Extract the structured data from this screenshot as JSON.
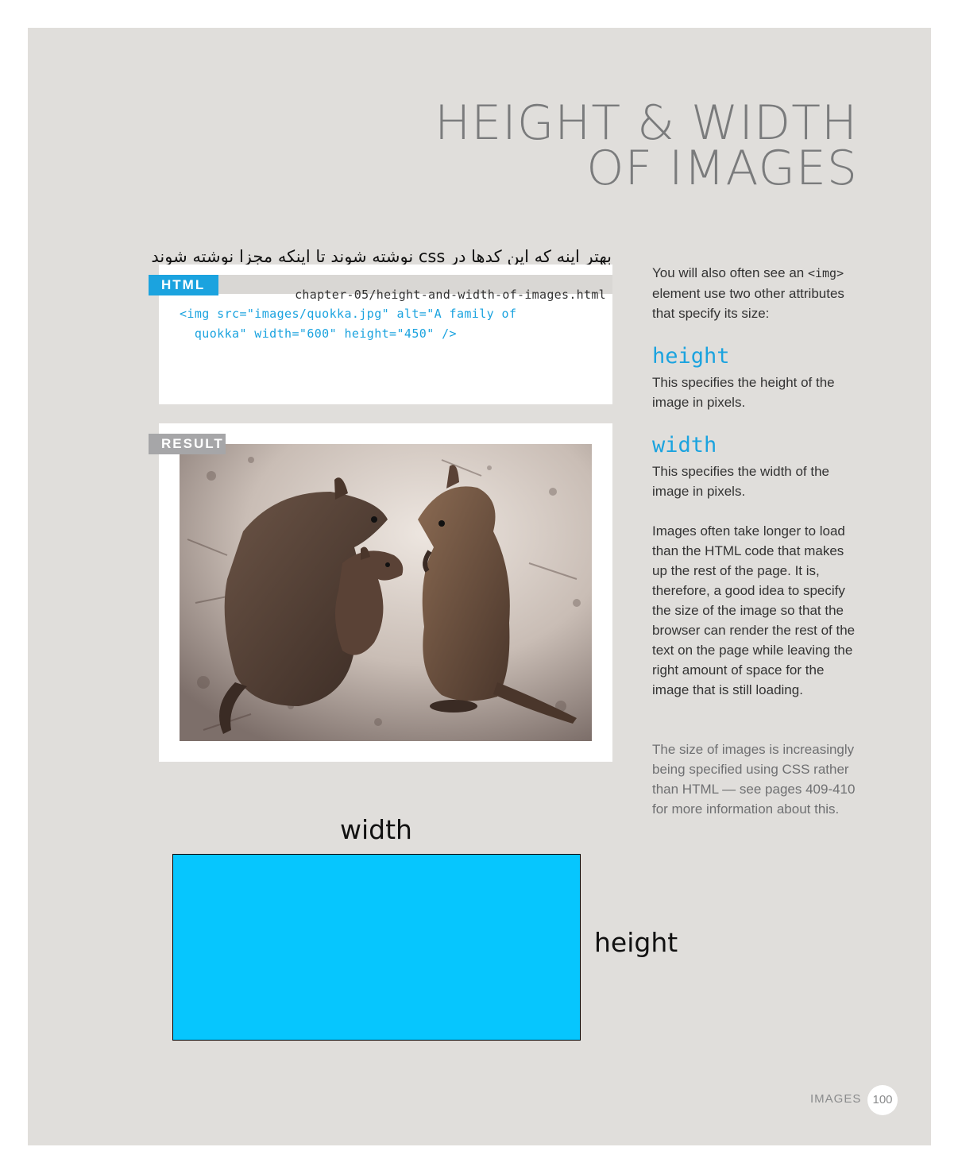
{
  "title": {
    "line1": "HEIGHT & WIDTH",
    "line2": "OF IMAGES"
  },
  "annotation": "بهتر اینه که این کدها در css نوشته شوند تا اینکه مجزا نوشته شوند",
  "html_panel": {
    "tag": "HTML",
    "filename": "chapter-05/height-and-width-of-images.html",
    "code_line1": "<img src=\"images/quokka.jpg\" alt=\"A family of",
    "code_line2": "  quokka\" width=\"600\" height=\"450\" />"
  },
  "result_panel": {
    "tag": "RESULT",
    "image": "quokka-family-photo"
  },
  "sidebar": {
    "intro_1": "You will also often see an ",
    "intro_code": "<img>",
    "intro_2": " element use two other attributes that specify its size:",
    "attr_height": "height",
    "desc_height": "This specifies the height of the image in pixels.",
    "attr_width": "width",
    "desc_width": "This specifies the width of the image in pixels.",
    "paragraph": "Images often take longer to load than the HTML code that makes up the rest of the page. It is, therefore, a good idea to specify the size of the image so that the browser can render the rest of the text on the page while leaving the right amount of space for the image that is still loading.",
    "note": "The size of images is increasingly being specified using CSS rather than HTML — see pages 409-410 for more information about this."
  },
  "diagram": {
    "width_label": "width",
    "height_label": "height",
    "box_color": "#06c6fe"
  },
  "footer": {
    "section": "IMAGES",
    "page": "100"
  }
}
